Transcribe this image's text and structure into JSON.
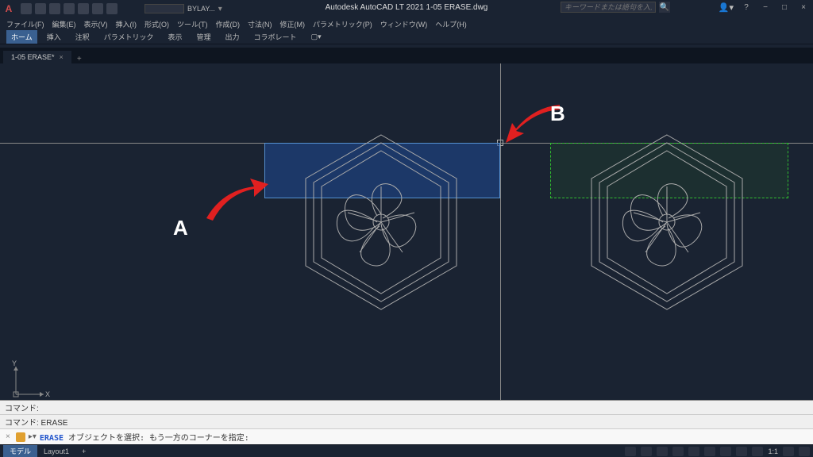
{
  "titlebar": {
    "app_logo": "A",
    "title": "Autodesk AutoCAD LT 2021   1-05 ERASE.dwg",
    "bylayer_label": "BYLAY...",
    "search_placeholder": "キーワードまたは語句を入力",
    "user_icon": "▲",
    "help_icon": "?"
  },
  "menubar": {
    "items": [
      "ファイル(F)",
      "編集(E)",
      "表示(V)",
      "挿入(I)",
      "形式(O)",
      "ツール(T)",
      "作成(D)",
      "寸法(N)",
      "修正(M)",
      "パラメトリック(P)",
      "ウィンドウ(W)",
      "ヘルプ(H)"
    ]
  },
  "ribbon_tabs": {
    "items": [
      "ホーム",
      "挿入",
      "注釈",
      "パラメトリック",
      "表示",
      "管理",
      "出力",
      "コラボレート"
    ],
    "active_index": 0
  },
  "doc_tabs": {
    "items": [
      {
        "label": "1-05 ERASE*",
        "close": "×"
      }
    ],
    "add_label": "+"
  },
  "canvas": {
    "ucs": {
      "x_label": "X",
      "y_label": "Y"
    },
    "annotations": {
      "a": "A",
      "b": "B"
    }
  },
  "cmdline": {
    "history1": "コマンド:",
    "history2": "コマンド: ERASE",
    "prompt_cmd": "ERASE",
    "prompt_text": " オブジェクトを選択: もう一方のコーナーを指定:"
  },
  "statusbar": {
    "model_tab": "モデル",
    "layout_tab": "Layout1",
    "add": "+",
    "scale": "1:1"
  },
  "chart_data": null
}
